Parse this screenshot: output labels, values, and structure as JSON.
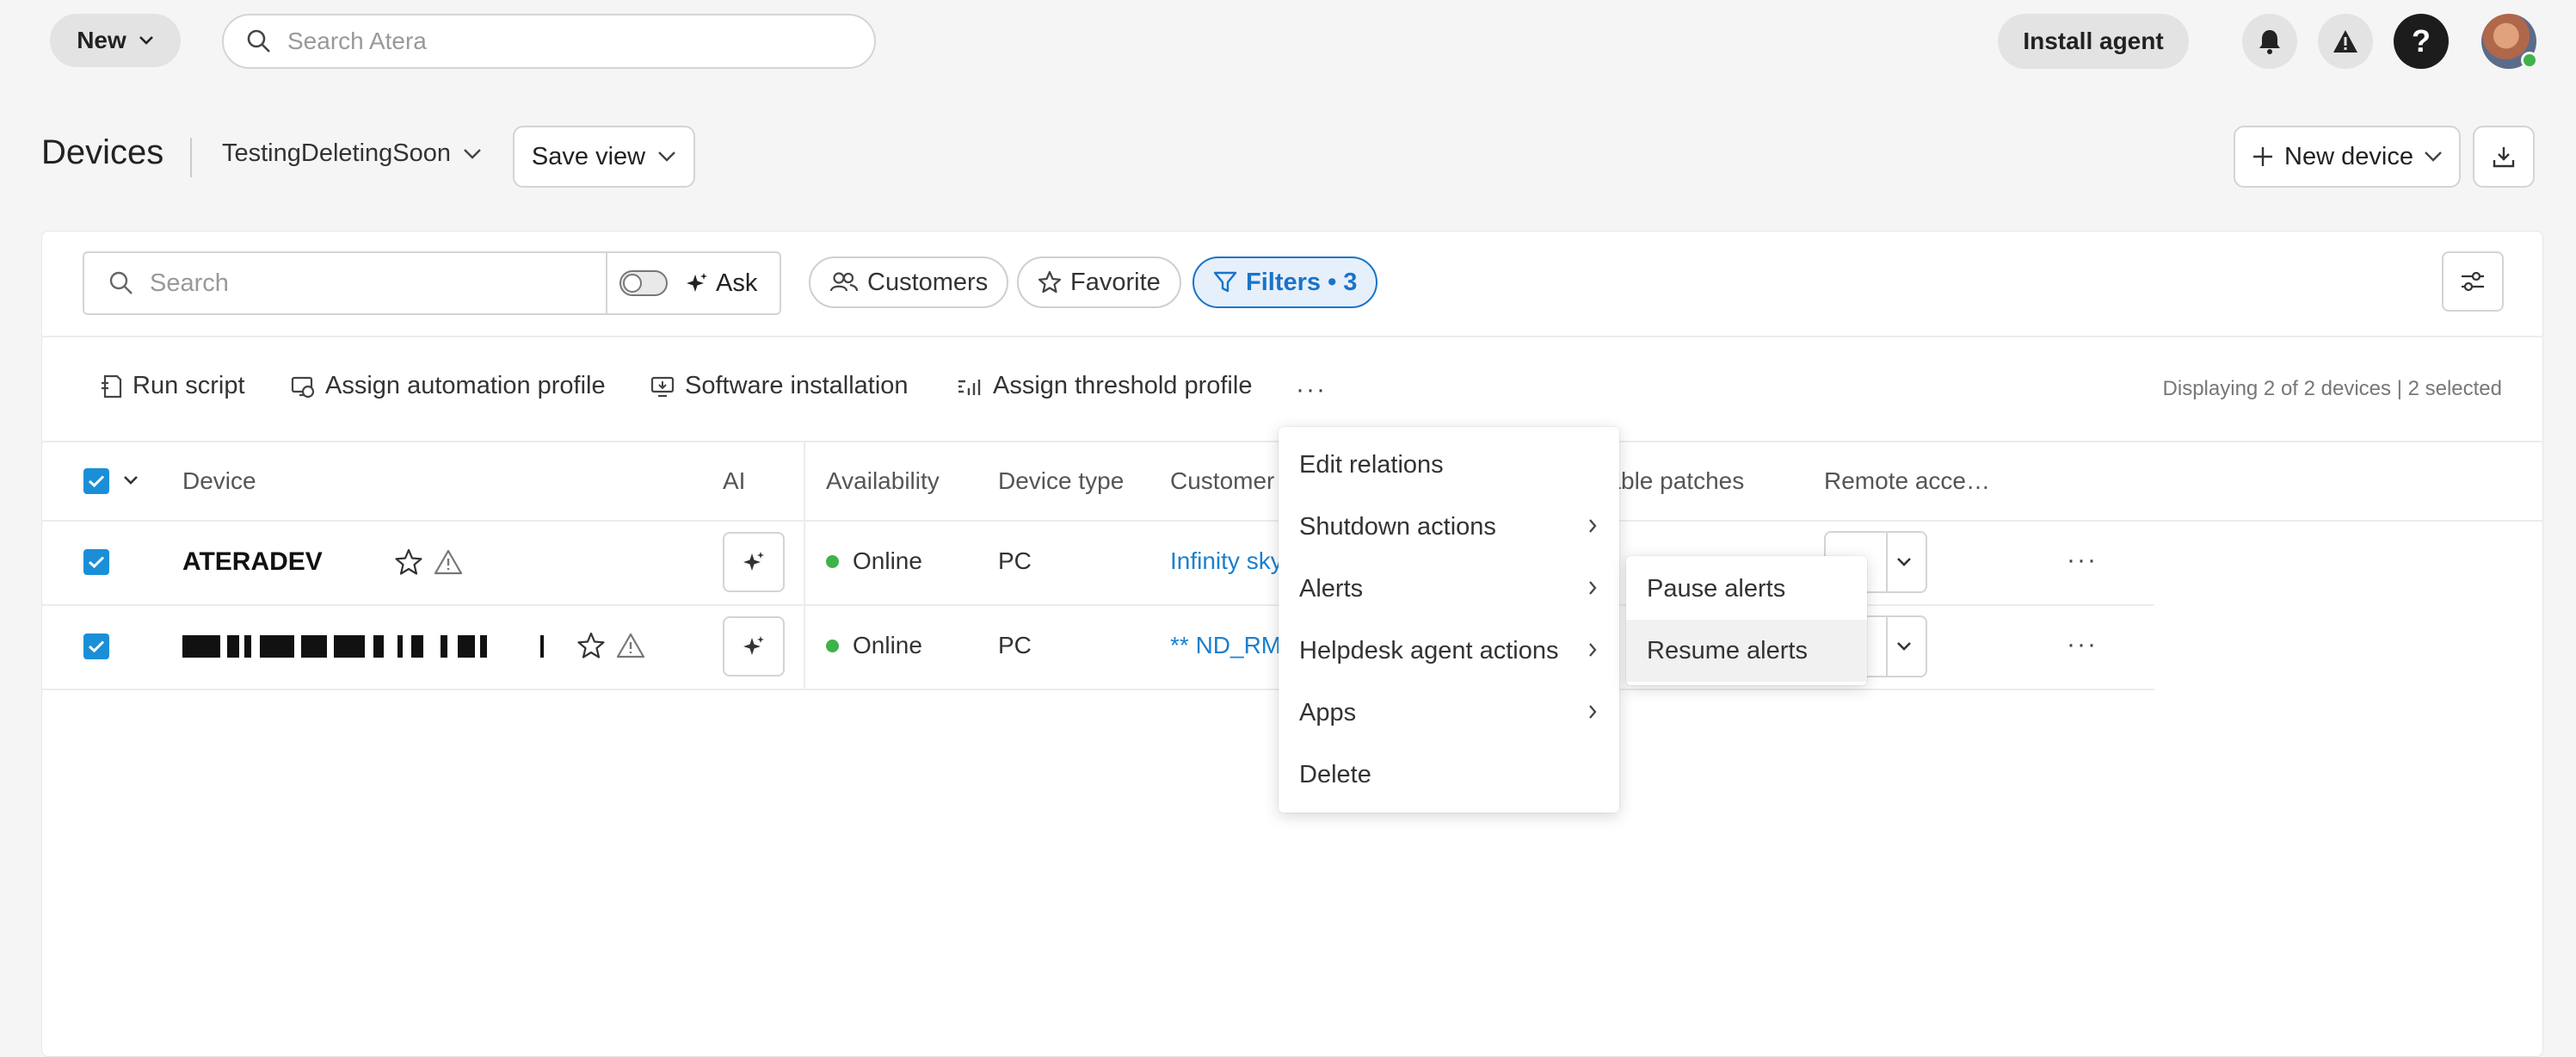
{
  "topbar": {
    "new_label": "New",
    "search_placeholder": "Search Atera",
    "install_label": "Install agent",
    "help_glyph": "?"
  },
  "header": {
    "title": "Devices",
    "view_name": "TestingDeletingSoon",
    "save_view_label": "Save view",
    "new_device_label": "New device"
  },
  "toolbar": {
    "search_placeholder": "Search",
    "ask_label": "Ask",
    "chips": {
      "customers": "Customers",
      "favorite": "Favorite",
      "filters": "Filters • 3"
    }
  },
  "actions": {
    "run_script": "Run script",
    "assign_automation": "Assign automation profile",
    "software_installation": "Software installation",
    "assign_threshold": "Assign threshold profile",
    "more": "···",
    "display_info": "Displaying 2 of 2 devices | 2 selected"
  },
  "table": {
    "columns": {
      "device": "Device",
      "ai": "AI",
      "availability": "Availability",
      "device_type": "Device type",
      "customer": "Customer",
      "patches": "ilable patches",
      "remote": "Remote acce…"
    },
    "rows": [
      {
        "device": "ATERADEV",
        "availability": "Online",
        "type": "PC",
        "customer": "Infinity sky",
        "more": "···"
      },
      {
        "device": "",
        "availability": "Online",
        "type": "PC",
        "customer": "** ND_RM",
        "more": "···"
      }
    ]
  },
  "context_menu": {
    "items": [
      "Edit relations",
      "Shutdown actions",
      "Alerts",
      "Helpdesk agent actions",
      "Apps",
      "Delete"
    ]
  },
  "submenu": {
    "items": [
      "Pause alerts",
      "Resume alerts"
    ]
  },
  "colors": {
    "accent": "#1a8fd8",
    "link": "#1a80d0",
    "online": "#3db34a"
  }
}
